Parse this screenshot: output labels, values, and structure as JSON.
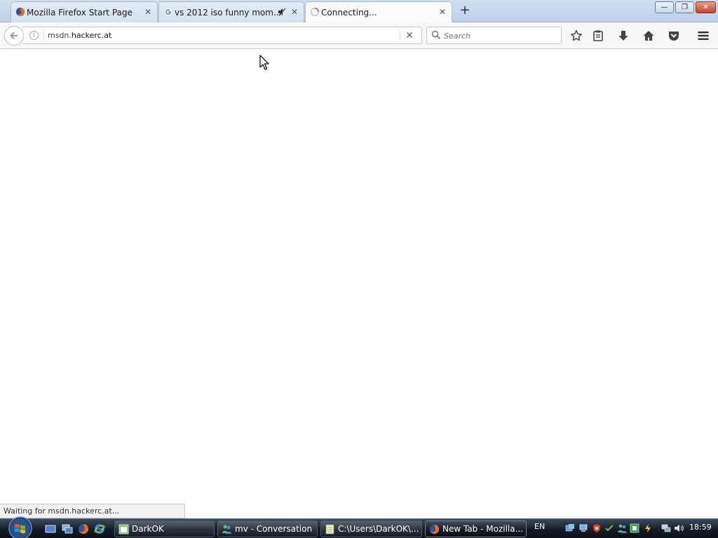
{
  "tabs": [
    {
      "label": "Mozilla Firefox Start Page",
      "icon": "firefox-icon"
    },
    {
      "label": "vs 2012 iso funny mom...",
      "icon": "google-icon",
      "muted": true
    },
    {
      "label": "Connecting...",
      "icon": "loading-spinner-icon",
      "active": true
    }
  ],
  "tab_close_glyph": "✕",
  "new_tab_glyph": "+",
  "window_controls": {
    "minimize": "—",
    "restore": "❐",
    "close": "✕"
  },
  "navbar": {
    "url_prefix": "msdn.",
    "url_host": "hackerc.at",
    "info_glyph": "i",
    "stop_glyph": "✕",
    "search_placeholder": "Search"
  },
  "status_text": "Waiting for msdn.hackerc.at...",
  "taskbar": {
    "tasks": [
      {
        "label": "DarkOK",
        "icon": "window-icon"
      },
      {
        "label": "mv - Conversation",
        "icon": "messenger-icon"
      },
      {
        "label": "C:\\Users\\DarkOK\\...",
        "icon": "notepad-icon"
      },
      {
        "label": "New Tab - Mozilla...",
        "icon": "firefox-icon",
        "active": true
      }
    ],
    "language": "EN",
    "clock": "18:59"
  },
  "colors": {
    "accent": "#3b78c4",
    "taskbar": "#141c26",
    "tab_bg": "#d3e1f0"
  }
}
